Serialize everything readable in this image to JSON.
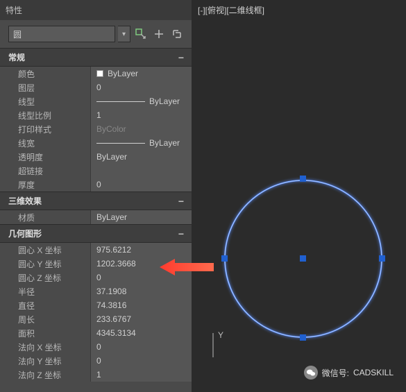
{
  "panel": {
    "title": "特性",
    "selector": "圆"
  },
  "viewport": {
    "label": "[-][俯视][二维线框]",
    "axis_y": "Y"
  },
  "watermark": {
    "label": "微信号:",
    "value": "CADSKILL"
  },
  "sections": {
    "general": {
      "title": "常规"
    },
    "threed": {
      "title": "三维效果"
    },
    "geometry": {
      "title": "几何图形"
    }
  },
  "props": {
    "color": {
      "label": "颜色",
      "value": "ByLayer"
    },
    "layer": {
      "label": "图层",
      "value": "0"
    },
    "linetype": {
      "label": "线型",
      "value": "ByLayer"
    },
    "ltscale": {
      "label": "线型比例",
      "value": "1"
    },
    "plotstyle": {
      "label": "打印样式",
      "value": "ByColor"
    },
    "lineweight": {
      "label": "线宽",
      "value": "ByLayer"
    },
    "transparency": {
      "label": "透明度",
      "value": "ByLayer"
    },
    "hyperlink": {
      "label": "超链接",
      "value": ""
    },
    "thickness": {
      "label": "厚度",
      "value": "0"
    },
    "material": {
      "label": "材质",
      "value": "ByLayer"
    },
    "centerx": {
      "label": "圆心 X 坐标",
      "value": "975.6212"
    },
    "centery": {
      "label": "圆心 Y 坐标",
      "value": "1202.3668"
    },
    "centerz": {
      "label": "圆心 Z 坐标",
      "value": "0"
    },
    "radius": {
      "label": "半径",
      "value": "37.1908"
    },
    "diameter": {
      "label": "直径",
      "value": "74.3816"
    },
    "circumference": {
      "label": "周长",
      "value": "233.6767"
    },
    "area": {
      "label": "面积",
      "value": "4345.3134"
    },
    "normalx": {
      "label": "法向 X 坐标",
      "value": "0"
    },
    "normaly": {
      "label": "法向 Y 坐标",
      "value": "0"
    },
    "normalz": {
      "label": "法向 Z 坐标",
      "value": "1"
    }
  }
}
